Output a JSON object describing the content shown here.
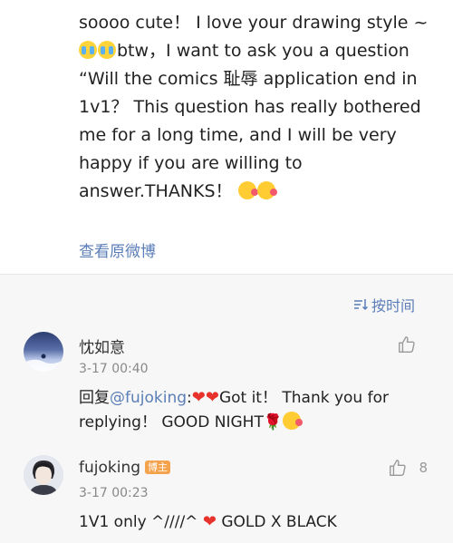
{
  "post": {
    "text_1": "soooo cute！ I love your drawing style ~ ",
    "text_2": "btw，I want to ask you a question “Will the comics 耻辱 application end in 1v1？ This question has really bothered me for a long time, and I will be very happy if you are willing to answer.THANKS！ ",
    "view_original": "查看原微博"
  },
  "sort": {
    "label": "按时间",
    "icon": "sort-icon"
  },
  "comments": [
    {
      "name": "忱如意",
      "time": "3-17 00:40",
      "reply_prefix": "回复",
      "mention": "@fujoking",
      "colon": ":",
      "hearts": "❤❤",
      "text": "Got it！ Thank you for replying！ GOOD NIGHT",
      "like_icon": "thumbs-up-icon",
      "like_count": ""
    },
    {
      "name": "fujoking",
      "badge": "博主",
      "time": "3-17 00:23",
      "text_a": "1V1 only ^////^ ",
      "heart": "❤",
      "text_b": " GOLD X BLACK",
      "like_icon": "thumbs-up-icon",
      "like_count": "8"
    }
  ],
  "colors": {
    "link": "#5b7eb8",
    "badge": "#f4a24b",
    "heart": "#e8322c"
  }
}
